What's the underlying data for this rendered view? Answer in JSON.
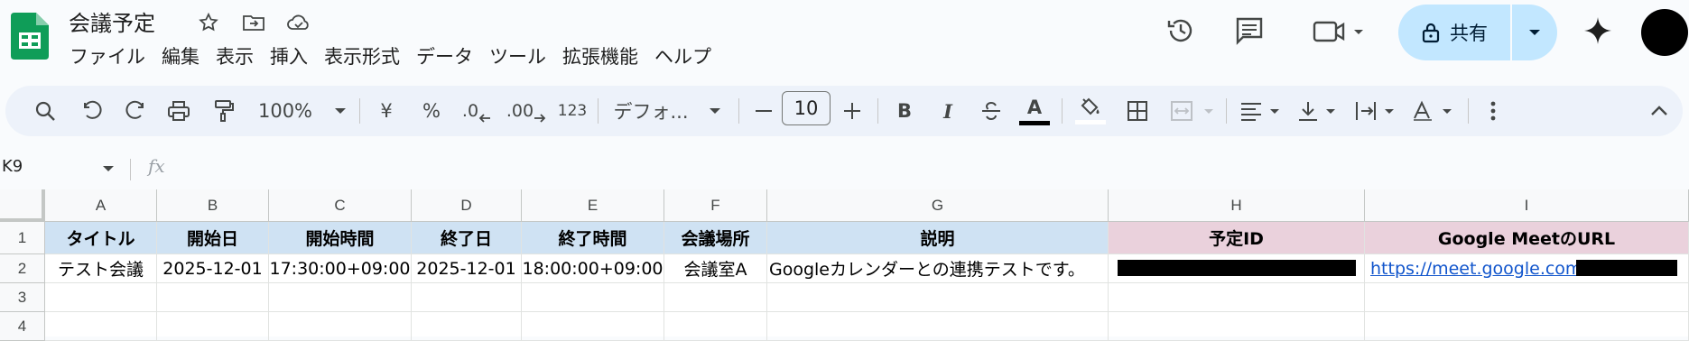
{
  "app": {
    "doc_title": "会議予定",
    "menu": [
      "ファイル",
      "編集",
      "表示",
      "挿入",
      "表示形式",
      "データ",
      "ツール",
      "拡張機能",
      "ヘルプ"
    ],
    "share_label": "共有"
  },
  "toolbar": {
    "zoom": "100%",
    "currency": "¥",
    "percent": "%",
    "decrease_decimal": ".0",
    "increase_decimal": ".00",
    "number_format": "123",
    "font": "デフォ...",
    "font_size": "10",
    "bold": "B",
    "italic": "I",
    "text_color_letter": "A",
    "text_color": "#000000"
  },
  "formula_bar": {
    "cell_ref": "K9",
    "fx": "fx"
  },
  "sheet": {
    "columns": [
      "A",
      "B",
      "C",
      "D",
      "E",
      "F",
      "G",
      "H",
      "I"
    ],
    "rows": [
      "1",
      "2",
      "3",
      "4"
    ],
    "header_row": [
      "タイトル",
      "開始日",
      "開始時間",
      "終了日",
      "終了時間",
      "会議場所",
      "説明",
      "予定ID",
      "Google MeetのURL"
    ],
    "data_row": [
      "テスト会議",
      "2025-12-01",
      "17:30:00+09:00",
      "2025-12-01",
      "18:00:00+09:00",
      "会議室A",
      "Googleカレンダーとの連携テストです。",
      "",
      "https://meet.google.com/"
    ],
    "header_fill_blue": "#cfe2f3",
    "header_fill_pink": "#ead1dc",
    "link_color": "#1155cc"
  }
}
